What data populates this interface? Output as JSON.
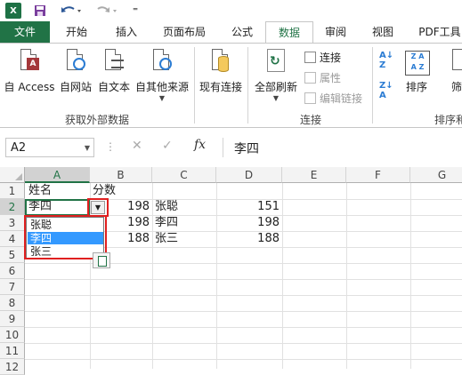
{
  "qat": {
    "logo": "X",
    "save_icon": "save-icon",
    "undo_icon": "undo-icon",
    "redo_icon": "redo-icon",
    "more": "⁼"
  },
  "tabs": {
    "file": "文件",
    "home": "开始",
    "insert": "插入",
    "layout": "页面布局",
    "formula": "公式",
    "data": "数据",
    "review": "审阅",
    "view": "视图",
    "pdf": "PDF工具"
  },
  "ribbon": {
    "get_external": {
      "from_access": "自 Access",
      "from_web": "自网站",
      "from_text": "自文本",
      "from_other": "自其他来源",
      "group_label": "获取外部数据"
    },
    "existing_connections": "现有连接",
    "connections": {
      "refresh_all": "全部刷新",
      "connections": "连接",
      "properties": "属性",
      "edit_links": "编辑链接",
      "group_label": "连接"
    },
    "sort_filter": {
      "sort": "排序",
      "filter": "筛",
      "group_label": "排序和"
    }
  },
  "formula_bar": {
    "name_box": "A2",
    "content": "李四"
  },
  "grid": {
    "columns": [
      "A",
      "B",
      "C",
      "D",
      "E",
      "F",
      "G"
    ],
    "rows": [
      "1",
      "2",
      "3",
      "4",
      "5",
      "6",
      "7",
      "8",
      "9",
      "10",
      "11",
      "12"
    ],
    "cells": {
      "A1": "姓名",
      "B1": "分数",
      "A2": "李四",
      "B2": "198",
      "C2": "张聪",
      "D2": "151",
      "B3": "198",
      "C3": "李四",
      "D3": "198",
      "B4": "188",
      "C4": "张三",
      "D4": "188"
    }
  },
  "dropdown": {
    "options": [
      "张聪",
      "李四",
      "张三"
    ],
    "selected": "李四"
  }
}
